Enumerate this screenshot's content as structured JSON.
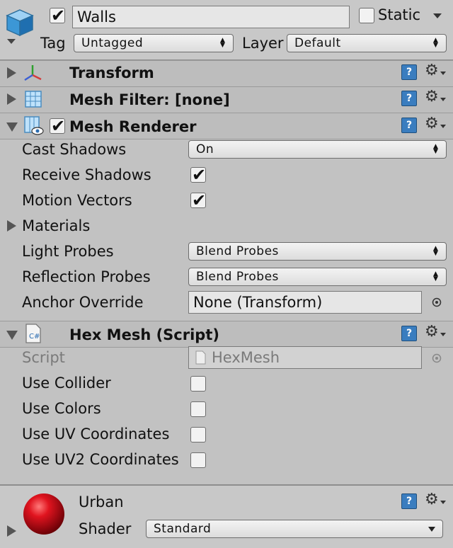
{
  "object": {
    "active": true,
    "name": "Walls",
    "static_label": "Static",
    "static": false,
    "tag_label": "Tag",
    "tag_value": "Untagged",
    "layer_label": "Layer",
    "layer_value": "Default",
    "icon": "cube-icon"
  },
  "components": {
    "transform": {
      "title": "Transform",
      "icon": "transform-axes-icon"
    },
    "mesh_filter": {
      "title": "Mesh Filter: [none]",
      "icon": "mesh-filter-icon"
    },
    "mesh_renderer": {
      "title": "Mesh Renderer",
      "enabled": true,
      "icon": "mesh-renderer-icon",
      "cast_shadows_label": "Cast Shadows",
      "cast_shadows_value": "On",
      "receive_shadows_label": "Receive Shadows",
      "receive_shadows": true,
      "motion_vectors_label": "Motion Vectors",
      "motion_vectors": true,
      "materials_label": "Materials",
      "light_probes_label": "Light Probes",
      "light_probes_value": "Blend Probes",
      "reflection_probes_label": "Reflection Probes",
      "reflection_probes_value": "Blend Probes",
      "anchor_override_label": "Anchor Override",
      "anchor_override_value": "None (Transform)"
    },
    "hex_mesh": {
      "title": "Hex Mesh (Script)",
      "icon": "csharp-script-icon",
      "script_label": "Script",
      "script_value": "HexMesh",
      "use_collider_label": "Use Collider",
      "use_colors_label": "Use Colors",
      "use_uv_label": "Use UV Coordinates",
      "use_uv2_label": "Use UV2 Coordinates"
    }
  },
  "material": {
    "name": "Urban",
    "shader_label": "Shader",
    "shader_value": "Standard",
    "icon": "red-sphere-icon"
  },
  "colors": {
    "panel": "#c2c2c2",
    "header": "#bdbdbd",
    "help_blue": "#3a7dbf",
    "sphere_red": "#d0101a"
  }
}
